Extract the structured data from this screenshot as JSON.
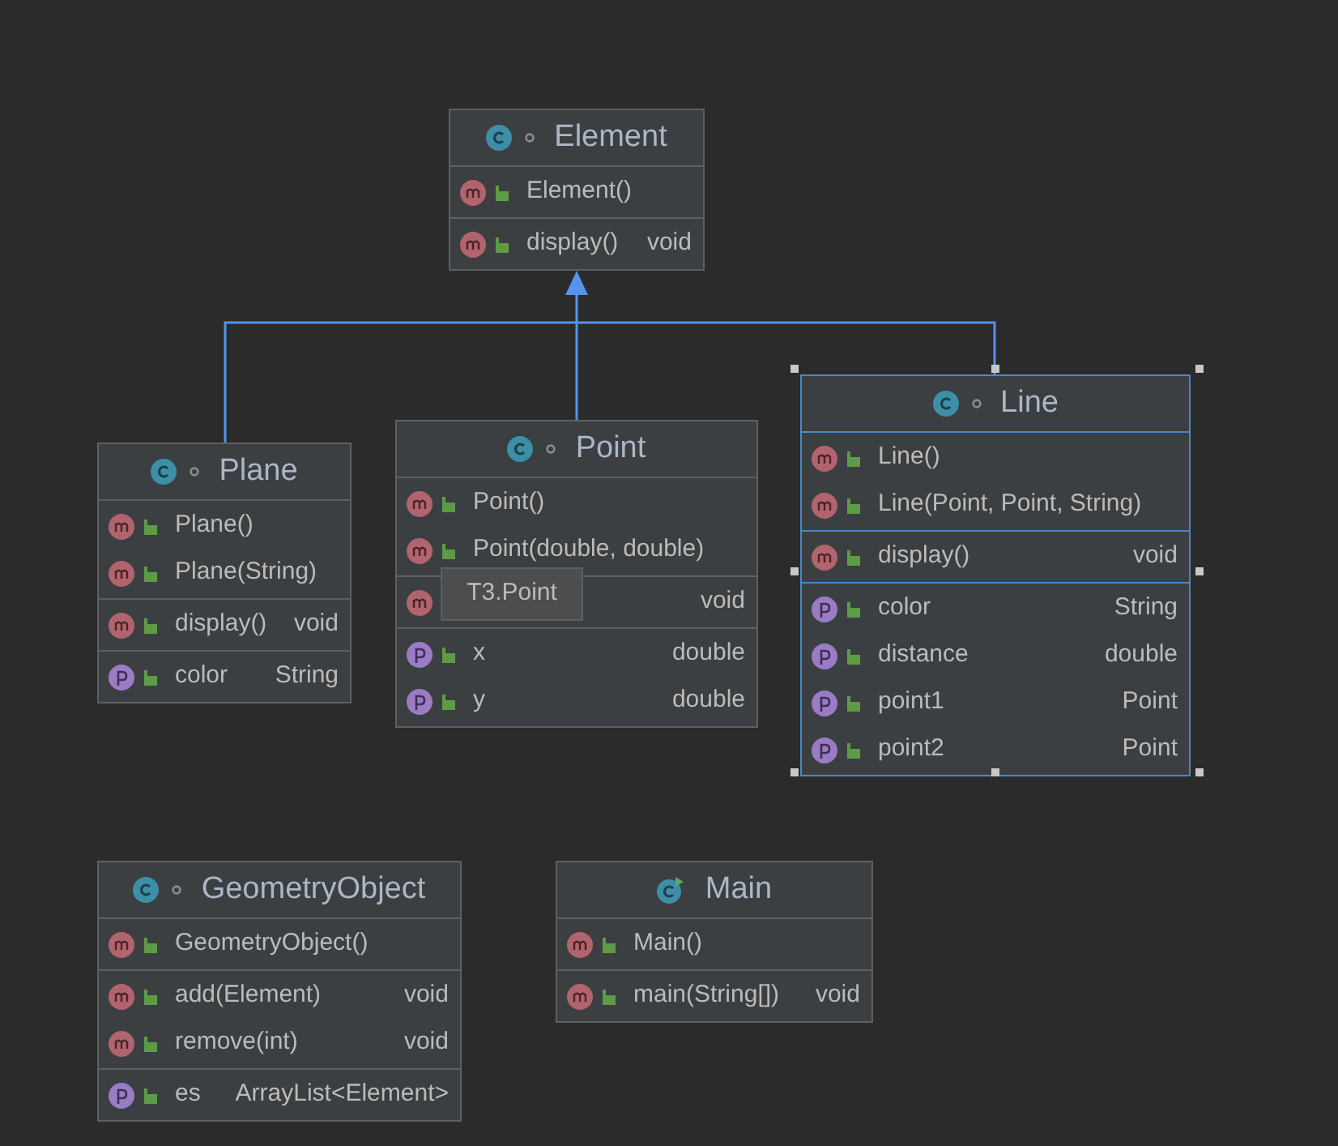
{
  "nodes": [
    {
      "title": "Element",
      "kind": "class",
      "selected": false,
      "sections": [
        [
          {
            "kind": "method",
            "name": "Element()"
          }
        ],
        [
          {
            "kind": "method",
            "name": "display()",
            "type": "void"
          }
        ]
      ]
    },
    {
      "title": "Plane",
      "kind": "class",
      "selected": false,
      "sections": [
        [
          {
            "kind": "method",
            "name": "Plane()"
          },
          {
            "kind": "method",
            "name": "Plane(String)"
          }
        ],
        [
          {
            "kind": "method",
            "name": "display()",
            "type": "void"
          }
        ],
        [
          {
            "kind": "field",
            "name": "color",
            "type": "String"
          }
        ]
      ]
    },
    {
      "title": "Point",
      "kind": "class",
      "selected": false,
      "sections": [
        [
          {
            "kind": "method",
            "name": "Point()"
          },
          {
            "kind": "method",
            "name": "Point(double, double)"
          }
        ],
        [
          {
            "kind": "method",
            "type": "void"
          }
        ],
        [
          {
            "kind": "field",
            "name": "x",
            "type": "double"
          },
          {
            "kind": "field",
            "name": "y",
            "type": "double"
          }
        ]
      ]
    },
    {
      "title": "Line",
      "kind": "class",
      "selected": true,
      "sections": [
        [
          {
            "kind": "method",
            "name": "Line()"
          },
          {
            "kind": "method",
            "name": "Line(Point, Point, String)"
          }
        ],
        [
          {
            "kind": "method",
            "name": "display()",
            "type": "void"
          }
        ],
        [
          {
            "kind": "field",
            "name": "color",
            "type": "String"
          },
          {
            "kind": "field",
            "name": "distance",
            "type": "double"
          },
          {
            "kind": "field",
            "name": "point1",
            "type": "Point"
          },
          {
            "kind": "field",
            "name": "point2",
            "type": "Point"
          }
        ]
      ]
    },
    {
      "title": "GeometryObject",
      "kind": "class",
      "selected": false,
      "sections": [
        [
          {
            "kind": "method",
            "name": "GeometryObject()"
          }
        ],
        [
          {
            "kind": "method",
            "name": "add(Element)",
            "type": "void"
          },
          {
            "kind": "method",
            "name": "remove(int)",
            "type": "void"
          }
        ],
        [
          {
            "kind": "field",
            "name": "es",
            "type": "ArrayList<Element>"
          }
        ]
      ]
    },
    {
      "title": "Main",
      "kind": "main",
      "selected": false,
      "sections": [
        [
          {
            "kind": "method",
            "name": "Main()"
          }
        ],
        [
          {
            "kind": "method",
            "name": "main(String[])",
            "type": "void"
          }
        ]
      ]
    }
  ],
  "tooltip": {
    "text": "T3.Point"
  }
}
